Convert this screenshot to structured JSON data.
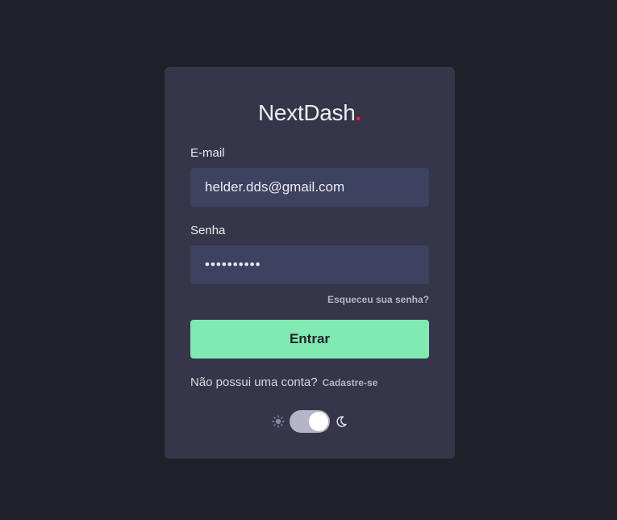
{
  "brand": {
    "name": "NextDash",
    "dot": ".",
    "dot_color": "#e0243f"
  },
  "form": {
    "email_label": "E-mail",
    "email_value": "helder.dds@gmail.com",
    "password_label": "Senha",
    "password_value": "••••••••••",
    "forgot_label": "Esqueceu sua senha?",
    "submit_label": "Entrar"
  },
  "signup": {
    "prompt": "Não possui uma conta?",
    "link_label": "Cadastre-se"
  },
  "theme": {
    "mode": "dark",
    "left_icon": "sun-icon",
    "right_icon": "moon-icon"
  },
  "colors": {
    "background": "#202029",
    "card": "#363549",
    "input": "#3c4260",
    "accent": "#81e9b2"
  }
}
